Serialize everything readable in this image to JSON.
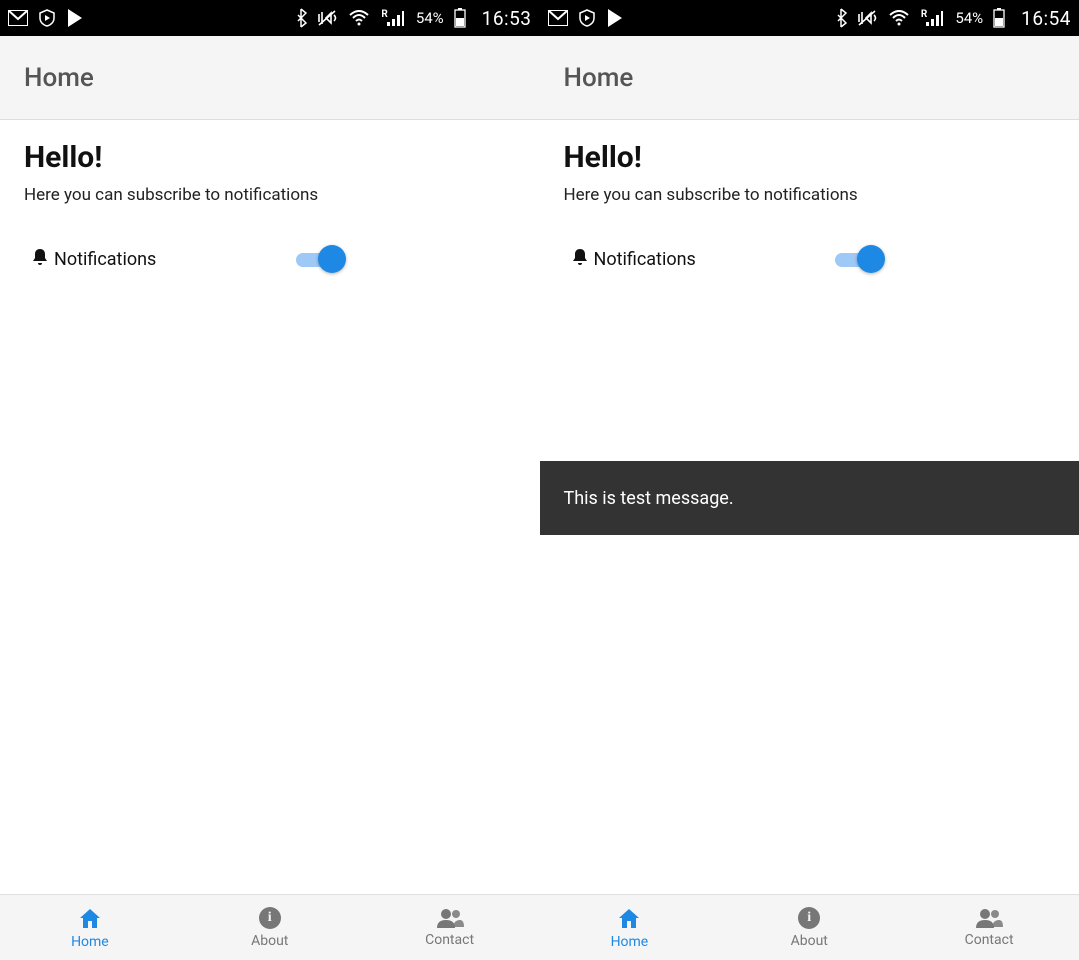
{
  "screens": [
    {
      "status": {
        "battery": "54%",
        "clock": "16:53"
      },
      "appbar": {
        "title": "Home"
      },
      "content": {
        "heading": "Hello!",
        "sub": "Here you can subscribe to notifications",
        "notif_label": "Notifications",
        "toggle_on": true
      },
      "snackbar": null,
      "nav": [
        {
          "label": "Home",
          "active": true
        },
        {
          "label": "About",
          "active": false
        },
        {
          "label": "Contact",
          "active": false
        }
      ]
    },
    {
      "status": {
        "battery": "54%",
        "clock": "16:54"
      },
      "appbar": {
        "title": "Home"
      },
      "content": {
        "heading": "Hello!",
        "sub": "Here you can subscribe to notifications",
        "notif_label": "Notifications",
        "toggle_on": true
      },
      "snackbar": {
        "text": "This is test message."
      },
      "nav": [
        {
          "label": "Home",
          "active": true
        },
        {
          "label": "About",
          "active": false
        },
        {
          "label": "Contact",
          "active": false
        }
      ]
    }
  ]
}
